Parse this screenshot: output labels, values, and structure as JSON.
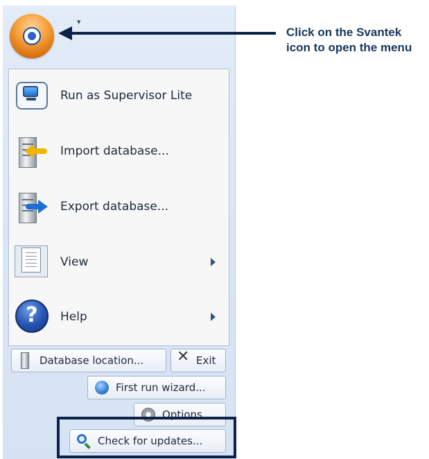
{
  "app_menu": {
    "items": [
      {
        "label": "Run as Supervisor Lite",
        "icon": "monitor-icon"
      },
      {
        "label": "Import database...",
        "icon": "import-database-icon"
      },
      {
        "label": "Export database...",
        "icon": "export-database-icon"
      },
      {
        "label": "View",
        "icon": "view-document-icon",
        "submenu": true
      },
      {
        "label": "Help",
        "icon": "help-icon",
        "submenu": true
      }
    ],
    "bottom_buttons": {
      "database_location": "Database location...",
      "exit": "Exit",
      "first_run_wizard": "First run wizard...",
      "options": "Options",
      "check_for_updates": "Check for updates..."
    }
  },
  "quick_access_toolbar": {
    "customize_glyph": "▾"
  },
  "annotation": {
    "text": "Click on the Svantek icon to open the menu"
  },
  "colors": {
    "annotation": "#17365d",
    "app_button": "#f6a23c",
    "pane_background": "#dbe7f6"
  }
}
